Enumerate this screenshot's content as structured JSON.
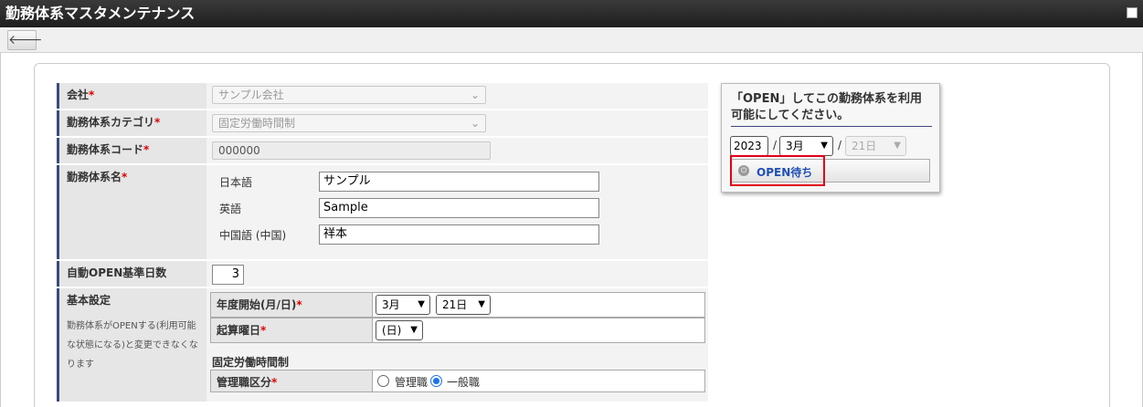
{
  "window": {
    "title": "勤務体系マスタメンテナンス"
  },
  "toolbar": {
    "back": "🡐"
  },
  "form": {
    "company": {
      "label": "会社",
      "required": "*",
      "value": "サンプル会社"
    },
    "category": {
      "label": "勤務体系カテゴリ",
      "required": "*",
      "value": "固定労働時間制"
    },
    "code": {
      "label": "勤務体系コード",
      "required": "*",
      "value": "000000"
    },
    "name": {
      "label": "勤務体系名",
      "required": "*",
      "langs": [
        {
          "lang": "日本語",
          "value": "サンプル"
        },
        {
          "lang": "英語",
          "value": "Sample"
        },
        {
          "lang": "中国語 (中国)",
          "value": "祥本"
        }
      ]
    },
    "auto_open": {
      "label": "自動OPEN基準日数",
      "value": "3"
    },
    "basic": {
      "label": "基本設定",
      "note": "勤務体系がOPENする(利用可能な状態になる)と変更できなくなります",
      "year_start": {
        "label": "年度開始(月/日)",
        "required": "*",
        "month": "3月",
        "day": "21日"
      },
      "base_weekday": {
        "label": "起算曜日",
        "required": "*",
        "value": "(日)"
      },
      "fixed_label": "固定労働時間制",
      "mgmt": {
        "label": "管理職区分",
        "required": "*",
        "options": [
          "管理職",
          "一般職"
        ],
        "selected": "一般職"
      }
    }
  },
  "open_panel": {
    "message": "「OPEN」してこの勤務体系を利用可能にしてください。",
    "year": "2023",
    "sep1": "/",
    "month": "3月",
    "sep2": "/",
    "day": "21日",
    "button": "OPEN待ち"
  }
}
